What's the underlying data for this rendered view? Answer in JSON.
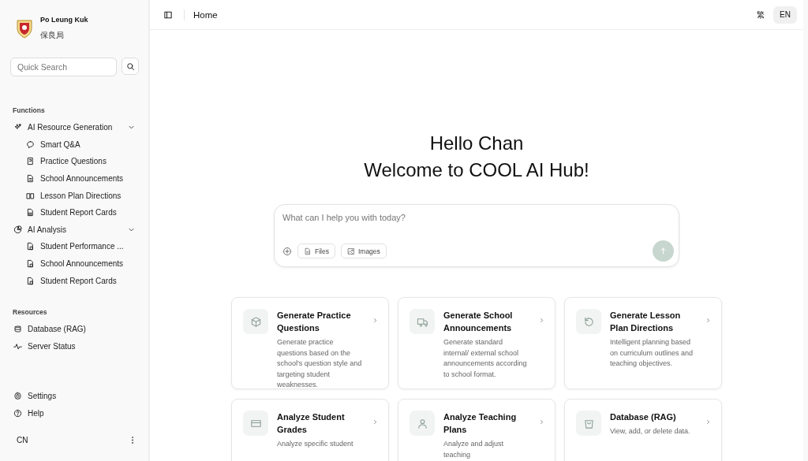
{
  "sidebar": {
    "org": {
      "name": "Po Leung Kuk",
      "name_local": "保良局"
    },
    "search": {
      "placeholder": "Quick Search"
    },
    "sections": [
      {
        "title": "Functions",
        "items": [
          {
            "label": "AI Resource Generation",
            "expanded": true,
            "children": [
              {
                "label": "Smart Q&A"
              },
              {
                "label": "Practice Questions"
              },
              {
                "label": "School Announcements"
              },
              {
                "label": "Lesson Plan Directions"
              },
              {
                "label": "Student Report Cards"
              }
            ]
          },
          {
            "label": "AI Analysis",
            "expanded": true,
            "children": [
              {
                "label": "Student Performance ..."
              },
              {
                "label": "School Announcements"
              },
              {
                "label": "Student Report Cards"
              }
            ]
          }
        ]
      },
      {
        "title": "Resources",
        "items": [
          {
            "label": "Database (RAG)"
          },
          {
            "label": "Server Status"
          }
        ]
      }
    ],
    "footer": [
      {
        "label": "Settings"
      },
      {
        "label": "Help"
      }
    ],
    "user": {
      "initials": "CN"
    }
  },
  "header": {
    "title": "Home",
    "languages": [
      {
        "label": "繁",
        "selected": false
      },
      {
        "label": "EN",
        "selected": true
      }
    ]
  },
  "greeting": [
    "Hello Chan",
    "Welcome to COOL AI Hub!"
  ],
  "chat": {
    "placeholder": "What can I help you with today?",
    "attachments": [
      "Files",
      "Images"
    ]
  },
  "cards": [
    {
      "title": "Generate Practice Questions",
      "description": "Generate practice questions based on the school's question style and targeting student weaknesses."
    },
    {
      "title": "Generate School Announcements",
      "description": "Generate standard internal/ external school announcements according to school format."
    },
    {
      "title": "Generate Lesson Plan Directions",
      "description": "Intelligent planning based on curriculum outlines and teaching objectives."
    },
    {
      "title": "Analyze Student Grades",
      "description": "Analyze specific student"
    },
    {
      "title": "Analyze Teaching Plans",
      "description": "Analyze and adjust teaching"
    },
    {
      "title": "Database (RAG)",
      "description": "View, add, or delete data."
    }
  ]
}
